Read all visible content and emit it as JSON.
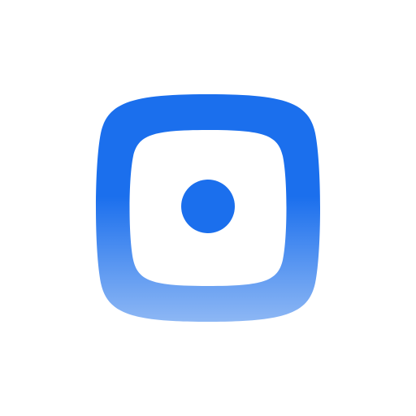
{
  "icon": {
    "name": "squircle-dot-icon",
    "colors": {
      "background": "#ffffff",
      "primary": "#1B6FED",
      "gradient_top": "#1B6FED",
      "gradient_mid": "#1B6FED",
      "gradient_bottom": "#8DB7F4"
    }
  }
}
